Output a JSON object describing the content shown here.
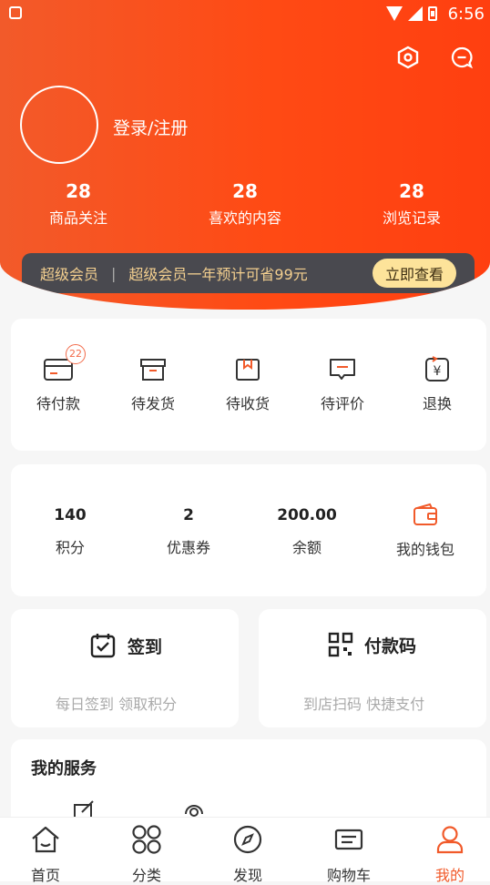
{
  "status_bar": {
    "time": "6:56"
  },
  "profile": {
    "login_label": "登录/注册"
  },
  "stats": [
    {
      "value": "28",
      "label": "商品关注"
    },
    {
      "value": "28",
      "label": "喜欢的内容"
    },
    {
      "value": "28",
      "label": "浏览记录"
    }
  ],
  "vip": {
    "title": "超级会员",
    "separator": "|",
    "promo": "超级会员一年预计可省99元",
    "button": "立即查看"
  },
  "orders": {
    "items": [
      {
        "label": "待付款",
        "badge": "22"
      },
      {
        "label": "待发货"
      },
      {
        "label": "待收货"
      },
      {
        "label": "待评价"
      },
      {
        "label": "退换"
      }
    ]
  },
  "assets": [
    {
      "value": "140",
      "label": "积分"
    },
    {
      "value": "2",
      "label": "优惠券"
    },
    {
      "value": "200.00",
      "label": "余额"
    },
    {
      "label": "我的钱包"
    }
  ],
  "checkin": {
    "title": "签到",
    "subtitle": "每日签到 领取积分"
  },
  "paycode": {
    "title": "付款码",
    "subtitle": "到店扫码 快捷支付"
  },
  "services": {
    "title": "我的服务"
  },
  "tabbar": {
    "tabs": [
      {
        "label": "首页"
      },
      {
        "label": "分类"
      },
      {
        "label": "发现"
      },
      {
        "label": "购物车"
      },
      {
        "label": "我的",
        "active": true
      }
    ]
  },
  "colors": {
    "accent": "#f15a2a",
    "vip_bg": "#49494f",
    "vip_text": "#f3cf8f",
    "vip_button": "#fde39a"
  }
}
